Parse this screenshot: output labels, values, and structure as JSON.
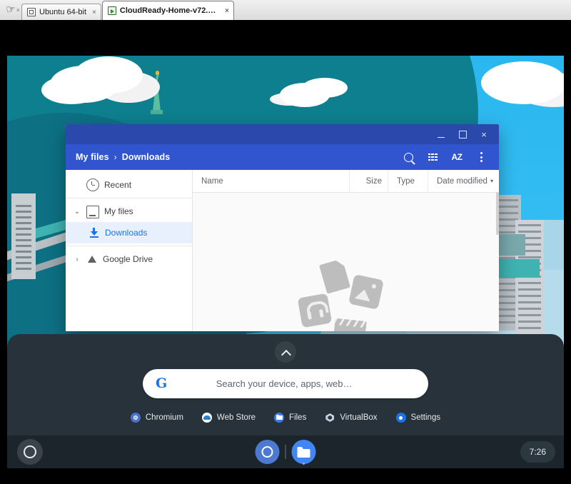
{
  "host": {
    "tabs": [
      {
        "label": "Ubuntu 64-bit",
        "close": "×",
        "active": false
      },
      {
        "label": "CloudReady-Home-v72.4-...",
        "close": "×",
        "active": true
      }
    ],
    "cursor_close": "×"
  },
  "files_window": {
    "window_controls": {
      "minimize": "",
      "maximize": "",
      "close": "×"
    },
    "breadcrumb": {
      "root": "My files",
      "separator": "›",
      "current": "Downloads"
    },
    "toolbar_icons": [
      "search-icon",
      "grid-view-icon",
      "sort-az-icon",
      "more-options-icon"
    ],
    "sort_label": "AZ",
    "sidebar": [
      {
        "label": "Recent",
        "icon": "clock-icon",
        "selected": false,
        "twisty": ""
      },
      {
        "label": "My files",
        "icon": "computer-icon",
        "selected": false,
        "twisty": "⌄"
      },
      {
        "label": "Downloads",
        "icon": "download-icon",
        "selected": true,
        "twisty": ""
      },
      {
        "label": "Google Drive",
        "icon": "drive-icon",
        "selected": false,
        "twisty": "›"
      }
    ],
    "columns": {
      "name": "Name",
      "size": "Size",
      "type": "Type",
      "date": "Date modified",
      "date_caret": "▾"
    },
    "empty_state": "no-files-illustration"
  },
  "launcher": {
    "expand_icon": "chevron-up-icon",
    "search_placeholder": "Search your device, apps, web…",
    "google_logo": "G",
    "apps": [
      {
        "label": "Chromium",
        "icon": "chromium-icon"
      },
      {
        "label": "Web Store",
        "icon": "web-store-icon"
      },
      {
        "label": "Files",
        "icon": "files-icon"
      },
      {
        "label": "VirtualBox",
        "icon": "virtualbox-icon"
      },
      {
        "label": "Settings",
        "icon": "settings-icon"
      }
    ]
  },
  "shelf": {
    "launcher_icon": "launcher-circle-icon",
    "pinned": [
      {
        "name": "chromium-shelf-icon"
      },
      {
        "name": "files-shelf-icon"
      }
    ],
    "clock": "7:26"
  },
  "wallpaper": {
    "name": "new-york-isometric-wallpaper",
    "colors": {
      "sky": "#2bb8f0",
      "hill": "#0e7f8f",
      "water": "#a8d6e8",
      "accent": "#3fb3b1"
    }
  },
  "theme": {
    "title_bar": "#2b48ad",
    "toolbar": "#3055cf",
    "selected_item": "#1a73e8",
    "launcher_bg": "#27323a",
    "shelf_bg": "#1b252b"
  }
}
